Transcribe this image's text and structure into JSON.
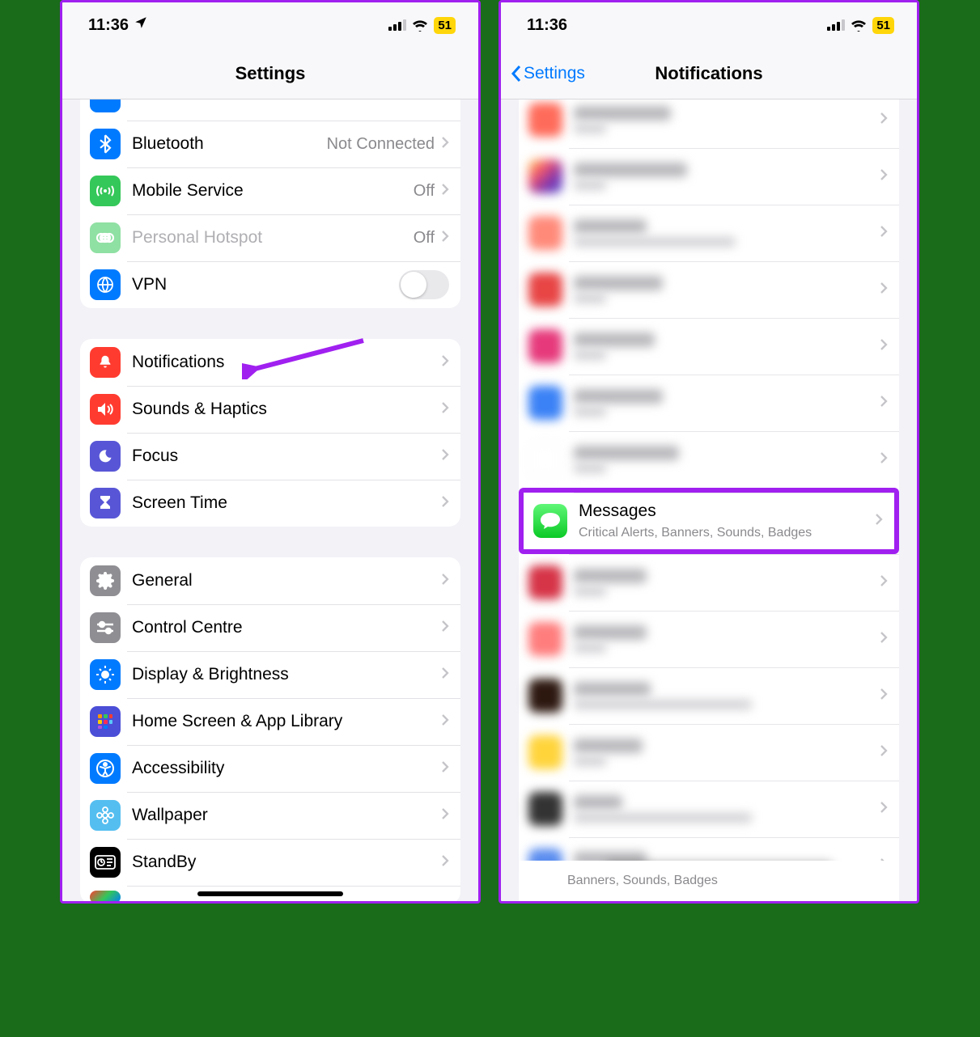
{
  "status": {
    "time": "11:36",
    "battery": "51"
  },
  "left": {
    "title": "Settings",
    "rows": {
      "bluetooth": {
        "label": "Bluetooth",
        "value": "Not Connected"
      },
      "mobile": {
        "label": "Mobile Service",
        "value": "Off"
      },
      "hotspot": {
        "label": "Personal Hotspot",
        "value": "Off"
      },
      "vpn": {
        "label": "VPN"
      },
      "notifications": {
        "label": "Notifications"
      },
      "sounds": {
        "label": "Sounds & Haptics"
      },
      "focus": {
        "label": "Focus"
      },
      "screentime": {
        "label": "Screen Time"
      },
      "general": {
        "label": "General"
      },
      "control": {
        "label": "Control Centre"
      },
      "display": {
        "label": "Display & Brightness"
      },
      "home": {
        "label": "Home Screen & App Library"
      },
      "accessibility": {
        "label": "Accessibility"
      },
      "wallpaper": {
        "label": "Wallpaper"
      },
      "standby": {
        "label": "StandBy"
      }
    }
  },
  "right": {
    "back": "Settings",
    "title": "Notifications",
    "messages": {
      "label": "Messages",
      "sub": "Critical Alerts, Banners, Sounds, Badges"
    },
    "bottom_sub": "Banners, Sounds, Badges"
  }
}
